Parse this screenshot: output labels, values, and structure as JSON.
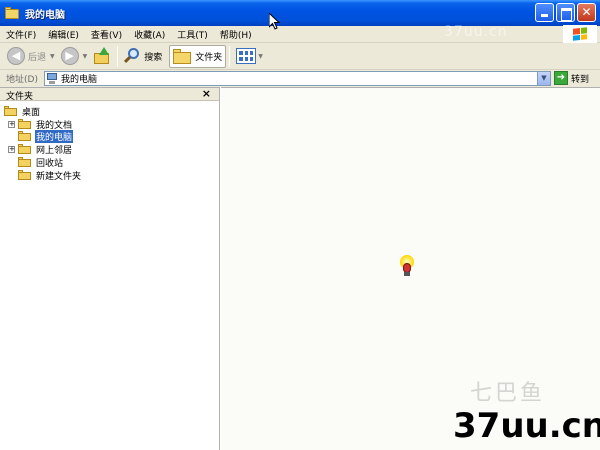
{
  "window": {
    "title": "我的电脑"
  },
  "menu": [
    "文件(F)",
    "编辑(E)",
    "查看(V)",
    "收藏(A)",
    "工具(T)",
    "帮助(H)"
  ],
  "toolbar": {
    "back_label": "后退",
    "search_label": "搜索",
    "folders_label": "文件夹"
  },
  "address": {
    "label": "地址(D)",
    "value": "我的电脑",
    "go_label": "转到"
  },
  "folders_pane": {
    "title": "文件夹",
    "close": "×",
    "items": [
      {
        "label": "桌面",
        "level": 0,
        "expander": ""
      },
      {
        "label": "我的文档",
        "level": 1,
        "expander": "+"
      },
      {
        "label": "我的电脑",
        "level": 1,
        "expander": "",
        "selected": true
      },
      {
        "label": "网上邻居",
        "level": 1,
        "expander": "+"
      },
      {
        "label": "回收站",
        "level": 1,
        "expander": ""
      },
      {
        "label": "新建文件夹",
        "level": 1,
        "expander": ""
      }
    ]
  },
  "watermarks": {
    "top": "37uu.cn",
    "middle": "七巴鱼",
    "brand": "37uu.cn"
  },
  "colors": {
    "titlebar": "#0054e3",
    "selection": "#316ac5",
    "chrome": "#ece9d8",
    "flag_red": "#f25022",
    "flag_green": "#7fba00",
    "flag_blue": "#00a4ef",
    "flag_yellow": "#ffb900"
  }
}
